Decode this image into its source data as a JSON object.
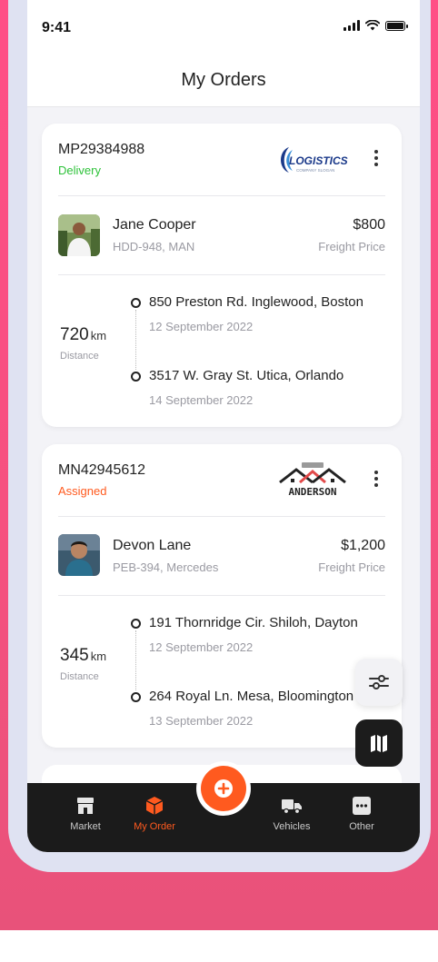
{
  "status_bar": {
    "time": "9:41"
  },
  "header": {
    "title": "My Orders"
  },
  "orders": [
    {
      "id": "MP29384988",
      "status": "Delivery",
      "status_color": "#2ec23a",
      "company": "LOGISTICS",
      "company_tagline": "COMPANY SLOGAN",
      "driver": {
        "name": "Jane Cooper",
        "vehicle": "HDD-948, MAN"
      },
      "price": "$800",
      "price_label": "Freight Price",
      "distance": "720",
      "distance_unit": "km",
      "distance_label": "Distance",
      "pickup": {
        "address": "850 Preston Rd. Inglewood, Boston",
        "date": "12 September 2022"
      },
      "dropoff": {
        "address": "3517 W. Gray St. Utica, Orlando",
        "date": "14 September 2022"
      }
    },
    {
      "id": "MN42945612",
      "status": "Assigned",
      "status_color": "#ff5a1f",
      "company": "ANDERSON",
      "driver": {
        "name": "Devon Lane",
        "vehicle": "PEB-394, Mercedes"
      },
      "price": "$1,200",
      "price_label": "Freight Price",
      "distance": "345",
      "distance_unit": "km",
      "distance_label": "Distance",
      "pickup": {
        "address": "191 Thornridge Cir. Shiloh, Dayton",
        "date": "12 September 2022"
      },
      "dropoff": {
        "address": "264 Royal Ln. Mesa, Bloomington",
        "date": "13 September 2022"
      }
    }
  ],
  "tabs": [
    {
      "label": "Market",
      "icon": "store-icon"
    },
    {
      "label": "My Order",
      "icon": "box-icon",
      "active": true
    },
    {
      "label": "Vehicles",
      "icon": "truck-icon"
    },
    {
      "label": "Other",
      "icon": "more-icon"
    }
  ],
  "colors": {
    "accent": "#ff5a1f",
    "delivery": "#2ec23a",
    "background_gradient": "#ff4f86"
  }
}
